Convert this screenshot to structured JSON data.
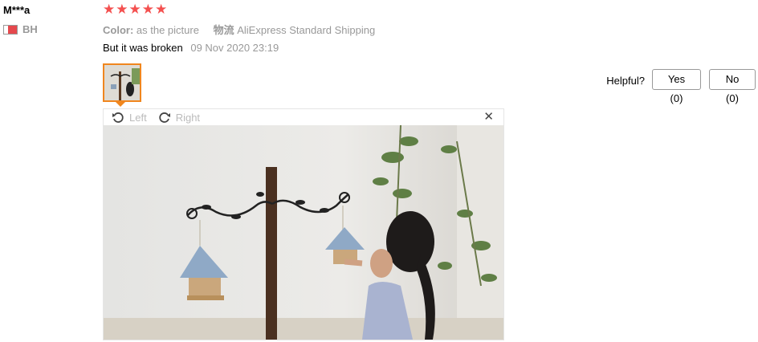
{
  "reviewer": {
    "name": "M***a",
    "country_code": "BH"
  },
  "rating": {
    "stars": 5,
    "star_char": "★",
    "color": "#f4504f"
  },
  "meta": {
    "color_label": "Color:",
    "color_value": "as the picture",
    "shipping_label": "物流",
    "shipping_value": "AliExpress Standard Shipping"
  },
  "feedback": {
    "text": "But it was broken",
    "date": "09 Nov 2020 23:19"
  },
  "helpful": {
    "label": "Helpful?",
    "yes": "Yes (0)",
    "no": "No (0)"
  },
  "viewer": {
    "rotate_left": "Left",
    "rotate_right": "Right",
    "close_glyph": "✕"
  },
  "colors": {
    "thumb_border": "#f0861e",
    "muted": "#999999"
  }
}
